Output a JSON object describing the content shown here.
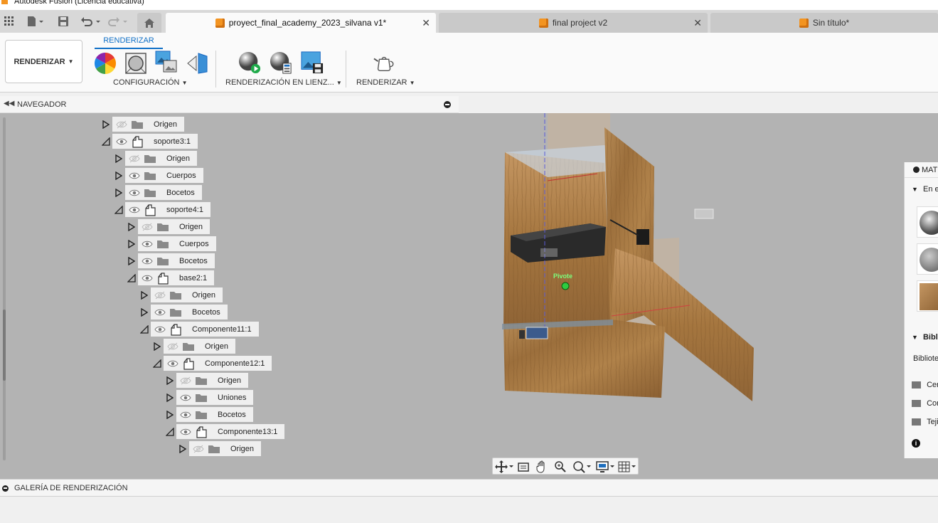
{
  "window": {
    "title": "Autodesk Fusion (Licencia educativa)"
  },
  "tabs": [
    {
      "label": "proyect_final_academy_2023_silvana v1*",
      "active": true
    },
    {
      "label": "final project v2",
      "active": false
    },
    {
      "label": "Sin título*",
      "active": false
    }
  ],
  "toolbar": {
    "workspace": "RENDERIZAR",
    "ribbon_tab": "RENDERIZAR",
    "groups": {
      "setup": "CONFIGURACIÓN",
      "incanvas": "RENDERIZACIÓN EN LIENZ...",
      "render": "RENDERIZAR"
    }
  },
  "navigator": {
    "header": "NAVEGADOR",
    "nodes": [
      {
        "label": "Origen",
        "kind": "folder",
        "visible": false,
        "expanded": false,
        "depth": 0
      },
      {
        "label": "soporte3:1",
        "kind": "component",
        "visible": true,
        "expanded": true,
        "depth": 0
      },
      {
        "label": "Origen",
        "kind": "folder",
        "visible": false,
        "expanded": false,
        "depth": 1
      },
      {
        "label": "Cuerpos",
        "kind": "folder",
        "visible": true,
        "expanded": false,
        "depth": 1
      },
      {
        "label": "Bocetos",
        "kind": "folder",
        "visible": true,
        "expanded": false,
        "depth": 1
      },
      {
        "label": "soporte4:1",
        "kind": "component",
        "visible": true,
        "expanded": true,
        "depth": 1
      },
      {
        "label": "Origen",
        "kind": "folder",
        "visible": false,
        "expanded": false,
        "depth": 2
      },
      {
        "label": "Cuerpos",
        "kind": "folder",
        "visible": true,
        "expanded": false,
        "depth": 2
      },
      {
        "label": "Bocetos",
        "kind": "folder",
        "visible": true,
        "expanded": false,
        "depth": 2
      },
      {
        "label": "base2:1",
        "kind": "component",
        "visible": true,
        "expanded": true,
        "depth": 2
      },
      {
        "label": "Origen",
        "kind": "folder",
        "visible": false,
        "expanded": false,
        "depth": 3
      },
      {
        "label": "Bocetos",
        "kind": "folder",
        "visible": true,
        "expanded": false,
        "depth": 3
      },
      {
        "label": "Componente11:1",
        "kind": "component",
        "visible": true,
        "expanded": true,
        "depth": 3
      },
      {
        "label": "Origen",
        "kind": "folder",
        "visible": false,
        "expanded": false,
        "depth": 4
      },
      {
        "label": "Componente12:1",
        "kind": "component",
        "visible": true,
        "expanded": true,
        "depth": 4
      },
      {
        "label": "Origen",
        "kind": "folder",
        "visible": false,
        "expanded": false,
        "depth": 5
      },
      {
        "label": "Uniones",
        "kind": "folder",
        "visible": true,
        "expanded": false,
        "depth": 5
      },
      {
        "label": "Bocetos",
        "kind": "folder",
        "visible": true,
        "expanded": false,
        "depth": 5
      },
      {
        "label": "Componente13:1",
        "kind": "component",
        "visible": true,
        "expanded": true,
        "depth": 5
      },
      {
        "label": "Origen",
        "kind": "folder",
        "visible": false,
        "expanded": false,
        "depth": 6
      }
    ]
  },
  "viewport": {
    "pivot_label": "Pivote"
  },
  "materials_panel": {
    "header": "MAT",
    "section_in_design": "En e",
    "section_library": "Bibli",
    "library_label": "Bibliote",
    "folders": [
      "Cer",
      "Cor",
      "Tejid"
    ]
  },
  "gallery": {
    "label": "GALERÍA DE RENDERIZACIÓN"
  },
  "colors": {
    "accent": "#0f6fc6",
    "brand": "#f39421",
    "wood": "#a5763f"
  }
}
